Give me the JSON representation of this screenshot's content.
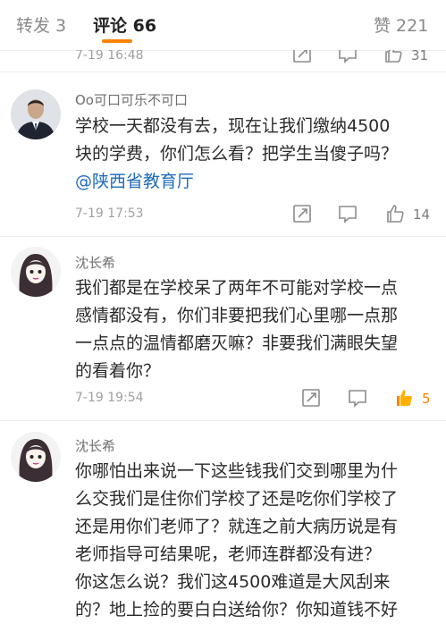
{
  "tabs": {
    "repost": "转发 3",
    "comment": "评论 66",
    "like": "赞 221"
  },
  "top_partial": {
    "time": "7-19 16:48",
    "likes": "31"
  },
  "comments": [
    {
      "user": "Oo可口可乐不可口",
      "text_lines": [
        "学校一天都没有去，现在让我们缴纳4500",
        "块的学费，你们怎么看？把学生当傻子吗？"
      ],
      "mention": "@陕西省教育厅",
      "time": "7-19 17:53",
      "likes": "14"
    },
    {
      "user": "沈长希",
      "text_lines": [
        "我们都是在学校呆了两年不可能对学校一点",
        "感情都没有，你们非要把我们心里哪一点那",
        "一点点的温情都磨灭嘛？非要我们满眼失望",
        "的看着你？"
      ],
      "time": "7-19 19:54",
      "likes": "5"
    },
    {
      "user": "沈长希",
      "text_lines": [
        "你哪怕出来说一下这些钱我们交到哪里为什",
        "么交我们是住你们学校了还是吃你们学校了",
        "还是用你们老师了？就连之前大病历说是有",
        "老师指导可结果呢，老师连群都没有进？",
        "你这怎么说？我们这4500难道是大风刮来",
        "的？地上捡的要白白送给你？你知道钱不好"
      ]
    }
  ],
  "colors": {
    "accent": "#ff8200",
    "mention": "#1e6bb8",
    "liked": "#ff8200"
  },
  "icons": [
    "repost-icon",
    "comment-icon",
    "like-icon",
    "avatar-businessman",
    "avatar-anime-girl"
  ]
}
